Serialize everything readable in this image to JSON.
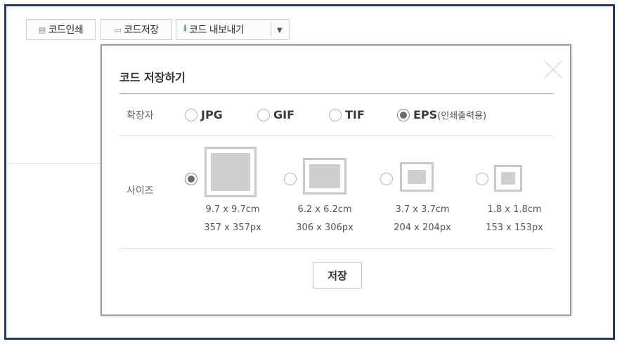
{
  "toolbar": {
    "print_label": "코드인쇄",
    "save_label": "코드저장",
    "export_label": "코드 내보내기"
  },
  "dialog": {
    "title": "코드 저장하기",
    "extension_label": "확장자",
    "formats": [
      {
        "label": "JPG",
        "selected": false
      },
      {
        "label": "GIF",
        "selected": false
      },
      {
        "label": "TIF",
        "selected": false
      },
      {
        "label": "EPS",
        "note": "(인쇄출력용)",
        "selected": true
      }
    ],
    "size_label": "사이즈",
    "sizes": [
      {
        "cm": "9.7 x 9.7cm",
        "px": "357 x 357px",
        "selected": true
      },
      {
        "cm": "6.2 x 6.2cm",
        "px": "306 x 306px",
        "selected": false
      },
      {
        "cm": "3.7 x 3.7cm",
        "px": "204 x 204px",
        "selected": false
      },
      {
        "cm": "1.8 x 1.8cm",
        "px": "153 x 153px",
        "selected": false
      }
    ],
    "save_button": "저장"
  },
  "colors": {
    "frame_border": "#1f3a6e",
    "export_icon": "#3aa24a"
  }
}
